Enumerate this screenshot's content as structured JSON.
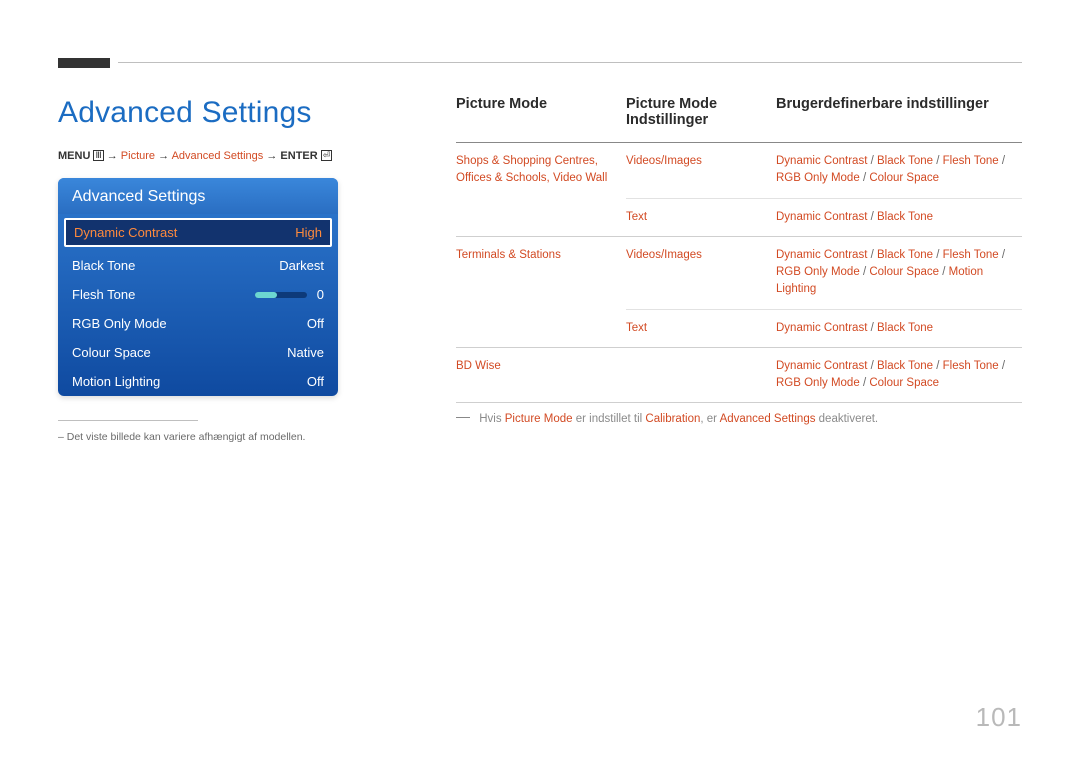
{
  "page_title": "Advanced Settings",
  "breadcrumb": {
    "menu": "MENU",
    "arrow": "→",
    "picture": "Picture",
    "advanced": "Advanced Settings",
    "enter": "ENTER"
  },
  "osd": {
    "title": "Advanced Settings",
    "rows": [
      {
        "label": "Dynamic Contrast",
        "value": "High",
        "selected": true
      },
      {
        "label": "Black Tone",
        "value": "Darkest"
      },
      {
        "label": "Flesh Tone",
        "value": "0",
        "slider": true
      },
      {
        "label": "RGB Only Mode",
        "value": "Off"
      },
      {
        "label": "Colour Space",
        "value": "Native"
      },
      {
        "label": "Motion Lighting",
        "value": "Off"
      }
    ]
  },
  "footnote": "– Det viste billede kan variere afhængigt af modellen.",
  "table": {
    "headers": {
      "c1": "Picture Mode",
      "c2": "Picture Mode Indstillinger",
      "c3": "Brugerdefinerbare indstillinger"
    },
    "rows": [
      {
        "c1": "Shops & Shopping Centres, Offices & Schools, Video Wall",
        "sub": [
          {
            "c2": "Videos/Images",
            "c3": "Dynamic Contrast / Black Tone / Flesh Tone / RGB Only Mode / Colour Space"
          },
          {
            "c2": "Text",
            "c3": "Dynamic Contrast / Black Tone"
          }
        ]
      },
      {
        "c1": "Terminals & Stations",
        "sub": [
          {
            "c2": "Videos/Images",
            "c3": "Dynamic Contrast / Black Tone / Flesh Tone / RGB Only Mode / Colour Space / Motion Lighting"
          },
          {
            "c2": "Text",
            "c3": "Dynamic Contrast / Black Tone"
          }
        ]
      },
      {
        "c1": "BD Wise",
        "sub": [
          {
            "c2": "",
            "c3": "Dynamic Contrast / Black Tone / Flesh Tone / RGB Only Mode / Colour Space"
          }
        ]
      }
    ]
  },
  "note": {
    "prefix": "Hvis ",
    "m1": "Picture Mode",
    "mid": " er indstillet til ",
    "m2": "Calibration",
    "mid2": ", er ",
    "m3": "Advanced Settings",
    "suffix": " deaktiveret."
  },
  "page_number": "101"
}
